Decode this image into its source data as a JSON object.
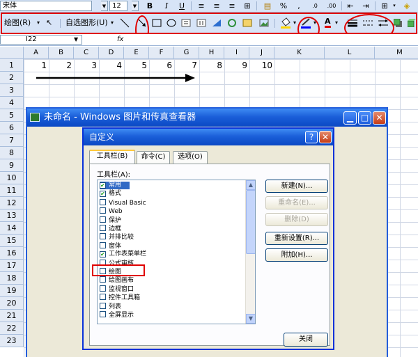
{
  "format_toolbar": {
    "font_name": "宋体",
    "font_size": "12",
    "bold": "B",
    "italic": "I",
    "underline": "U",
    "percent": "%",
    "comma": ","
  },
  "draw_toolbar": {
    "draw_label": "绘图(R)",
    "autoshape_label": "自选图形(U)"
  },
  "formula_bar": {
    "name_box": "I22",
    "fx": "fx"
  },
  "columns": [
    "A",
    "B",
    "C",
    "D",
    "E",
    "F",
    "G",
    "H",
    "I",
    "J",
    "K",
    "L",
    "M"
  ],
  "rows": [
    "1",
    "2",
    "3",
    "4",
    "5",
    "6",
    "7",
    "8",
    "9",
    "10",
    "11",
    "12",
    "13",
    "14",
    "15",
    "16",
    "17",
    "18",
    "19",
    "20",
    "21",
    "22",
    "23"
  ],
  "row1_values": [
    "1",
    "2",
    "3",
    "4",
    "5",
    "6",
    "7",
    "8",
    "9",
    "10"
  ],
  "viewer": {
    "title": "未命名 - Windows 图片和传真查看器"
  },
  "dialog": {
    "title": "自定义",
    "help": "?",
    "tabs": [
      "工具栏(B)",
      "命令(C)",
      "选项(O)"
    ],
    "toolbars_label": "工具栏(A):",
    "toolbars": [
      {
        "label": "常用",
        "checked": true,
        "selected": true
      },
      {
        "label": "格式",
        "checked": true
      },
      {
        "label": "Visual Basic"
      },
      {
        "label": "Web"
      },
      {
        "label": "保护"
      },
      {
        "label": "边框"
      },
      {
        "label": "并排比较"
      },
      {
        "label": "窗体"
      },
      {
        "label": "工作表菜单栏",
        "checked": true
      },
      {
        "label": "公式审核"
      },
      {
        "label": "绘图"
      },
      {
        "label": "绘图画布"
      },
      {
        "label": "监视窗口"
      },
      {
        "label": "控件工具箱"
      },
      {
        "label": "列表"
      },
      {
        "label": "全屏显示"
      }
    ],
    "buttons": {
      "new": "新建(N)...",
      "rename": "重命名(E)...",
      "delete": "删除(D)",
      "reset": "重新设置(R)...",
      "attach": "附加(H)..."
    },
    "close": "关闭"
  },
  "colors": {
    "annotation": "#e00000",
    "title_bar": "#0a48c4"
  }
}
